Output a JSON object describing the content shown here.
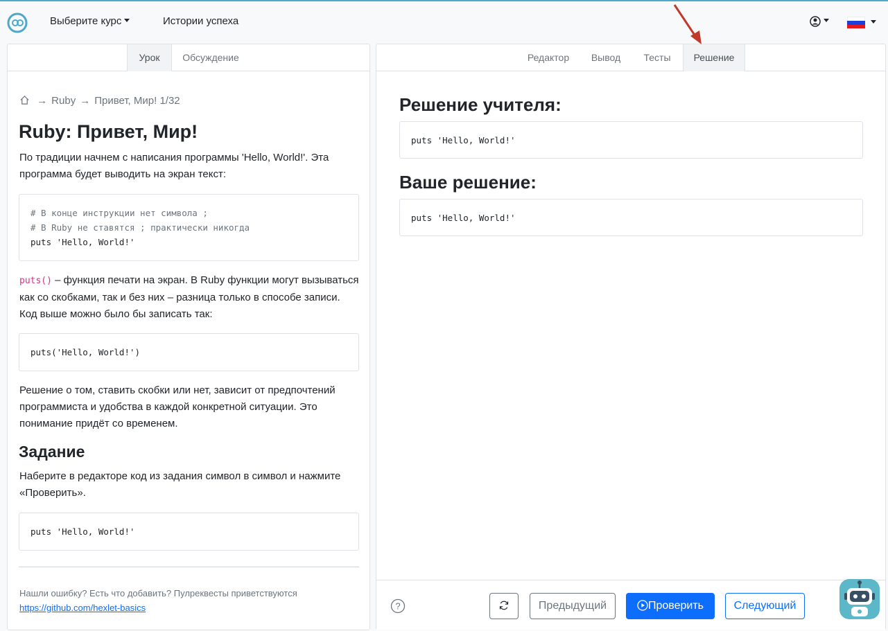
{
  "navbar": {
    "logo_icon": "hexlet-logo-icon",
    "course_menu_label": "Выберите курс",
    "success_stories_label": "Истории успеха",
    "user_icon": "user-circle-icon",
    "language_flag": "russian-flag-icon"
  },
  "lesson": {
    "tabs": [
      {
        "label": "Урок",
        "active": true
      },
      {
        "label": "Обсуждение",
        "active": false
      }
    ],
    "breadcrumb": {
      "home_icon": "home-icon",
      "sep1": "→",
      "course": "Ruby",
      "sep2": "→",
      "lesson": "Привет, Мир! 1/32"
    },
    "title": "Ruby: Привет, Мир!",
    "intro": "По традиции начнем с написания программы 'Hello, World!'. Эта программа будет выводить на экран текст:",
    "code1": {
      "comment1": "# В конце инструкции нет символа ;",
      "comment2": "# В Ruby не ставятся ; практически никогда",
      "line": "puts 'Hello, World!'"
    },
    "puts_code": "puts()",
    "puts_desc": " – функция печати на экран. В Ruby функции могут вызываться как со скобками, так и без них – разница только в способе записи. Код выше можно было бы записать так:",
    "code2": "puts('Hello, World!')",
    "decision_text": "Решение о том, ставить скобки или нет, зависит от предпочтений программиста и удобства в каждой конкретной ситуации. Это понимание придёт со временем.",
    "task_title": "Задание",
    "task_text": "Наберите в редакторе код из задания символ в символ и нажмите «Проверить».",
    "task_code": "puts 'Hello, World!'",
    "footer_text": "Нашли ошибку? Есть что добавить? Пулреквесты приветствуются",
    "footer_link": "https://github.com/hexlet-basics"
  },
  "workspace": {
    "tabs": [
      {
        "label": "Редактор",
        "active": false
      },
      {
        "label": "Вывод",
        "active": false
      },
      {
        "label": "Тесты",
        "active": false
      },
      {
        "label": "Решение",
        "active": true
      }
    ],
    "teacher_title": "Решение учителя:",
    "teacher_code": "puts 'Hello, World!'",
    "your_title": "Ваше решение:",
    "your_code": "puts 'Hello, World!'",
    "help_icon": "question-circle-icon",
    "reset_icon": "refresh-icon",
    "prev_label": "Предыдущий",
    "check_icon": "play-circle-icon",
    "check_label": "Проверить",
    "next_label": "Следующий",
    "assistant_icon": "robot-assistant-icon"
  },
  "colors": {
    "primary": "#0d6efd",
    "annotation_arrow": "#c0392b",
    "accent_top": "#4ea8c7"
  }
}
